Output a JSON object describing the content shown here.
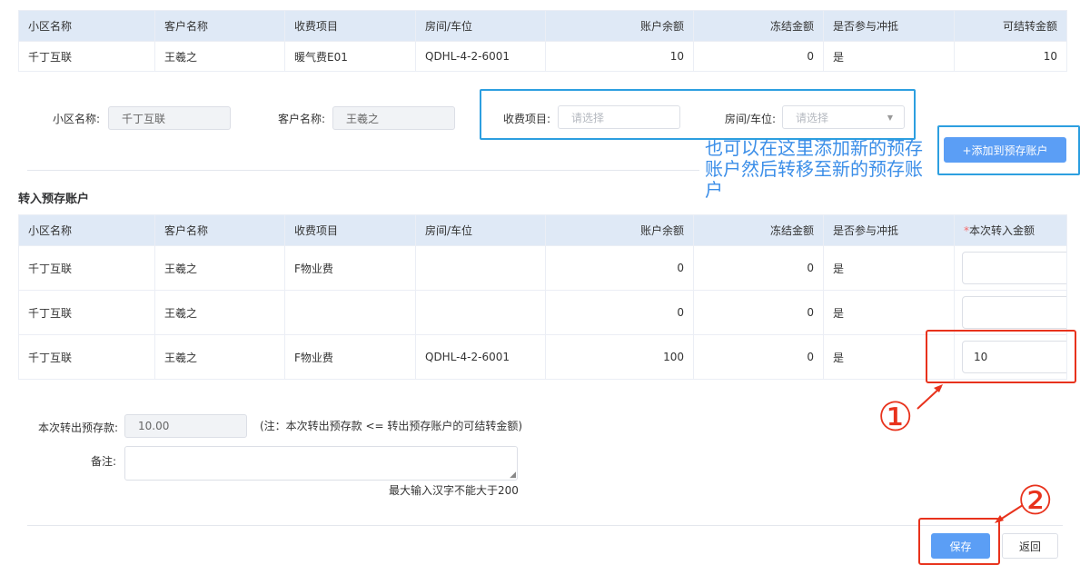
{
  "source_table": {
    "headers": [
      "小区名称",
      "客户名称",
      "收费项目",
      "房间/车位",
      "账户余额",
      "冻结金额",
      "是否参与冲抵",
      "可结转金额"
    ],
    "rows": [
      [
        "千丁互联",
        "王羲之",
        "暖气费E01",
        "QDHL-4-2-6001",
        "10",
        "0",
        "是",
        "10"
      ]
    ]
  },
  "form": {
    "community_label": "小区名称:",
    "community_value": "千丁互联",
    "customer_label": "客户名称:",
    "customer_value": "王羲之",
    "fee_item_label": "收费项目:",
    "fee_item_placeholder": "请选择",
    "room_label": "房间/车位:",
    "room_placeholder": "请选择",
    "add_button": "+添加到预存账户"
  },
  "annotation_text": "也可以在这里添加新的预存账户然后转移至新的预存账户",
  "transfer_section": {
    "title": "转入预存账户",
    "required_mark": "*",
    "headers": [
      "小区名称",
      "客户名称",
      "收费项目",
      "房间/车位",
      "账户余额",
      "冻结金额",
      "是否参与冲抵",
      "本次转入金额"
    ],
    "rows": [
      [
        "千丁互联",
        "王羲之",
        "F物业费",
        "",
        "0",
        "0",
        "是",
        ""
      ],
      [
        "千丁互联",
        "王羲之",
        "",
        "",
        "0",
        "0",
        "是",
        ""
      ],
      [
        "千丁互联",
        "王羲之",
        "F物业费",
        "QDHL-4-2-6001",
        "100",
        "0",
        "是",
        "10"
      ]
    ]
  },
  "summary": {
    "out_label": "本次转出预存款:",
    "out_value": "10.00",
    "out_note": "(注：本次转出预存款 <= 转出预存账户的可结转金额)",
    "remark_label": "备注:",
    "remark_hint": "最大输入汉字不能大于200"
  },
  "markers": {
    "step1": "①",
    "step2": "②"
  },
  "actions": {
    "save": "保存",
    "back": "返回"
  },
  "colors": {
    "header_bg": "#dfe9f6",
    "primary": "#5b9ef5",
    "highlight_blue": "#2d9fe0",
    "highlight_red": "#e8321c",
    "annotation_text": "#3b8ee8"
  }
}
